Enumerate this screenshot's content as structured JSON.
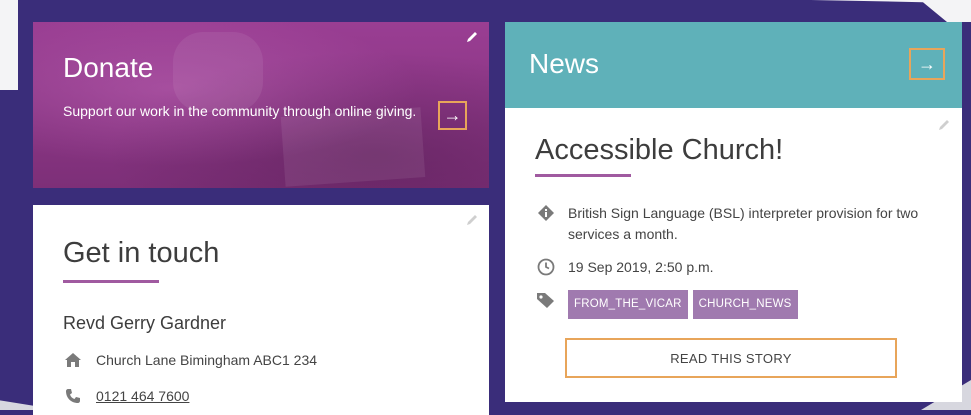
{
  "donate": {
    "title": "Donate",
    "text": "Support our work in the community through online giving.",
    "arrow": "→"
  },
  "touch": {
    "title": "Get in touch",
    "name": "Revd Gerry Gardner",
    "address": "Church Lane Bimingham ABC1 234",
    "phone": "0121 464 7600"
  },
  "news": {
    "header_title": "News",
    "arrow": "→",
    "story": {
      "title": "Accessible Church!",
      "summary": "British Sign Language (BSL) interpreter provision for two services a month.",
      "date": "19 Sep 2019, 2:50 p.m.",
      "tags": [
        "FROM_THE_VICAR",
        "CHURCH_NEWS"
      ],
      "button_label": "READ THIS STORY"
    }
  },
  "icons": {
    "edit": "pencil-icon",
    "info": "info-diamond-icon",
    "clock": "clock-icon",
    "tag": "tag-icon",
    "home": "home-icon",
    "phone": "phone-icon"
  },
  "colors": {
    "background": "#3a2d7a",
    "donate": "#8b3a86",
    "news_header": "#5fb1b9",
    "accent_border": "#e8a55a",
    "underline": "#a05aa0",
    "tag": "#a07aaf"
  }
}
